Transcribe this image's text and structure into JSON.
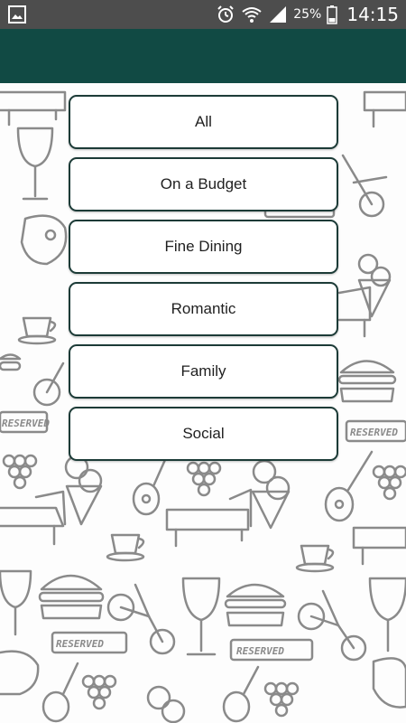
{
  "status_bar": {
    "battery": "25%",
    "time": "14:15",
    "icons": [
      "image-icon",
      "alarm-icon",
      "wifi-icon",
      "signal-icon",
      "battery-icon"
    ]
  },
  "app_bar": {
    "color": "#114a44"
  },
  "categories": [
    {
      "label": "All"
    },
    {
      "label": "On a Budget"
    },
    {
      "label": "Fine Dining"
    },
    {
      "label": "Romantic"
    },
    {
      "label": "Family"
    },
    {
      "label": "Social"
    }
  ],
  "background": {
    "doodle_texts": [
      "RESERVED",
      "RESERVED",
      "RESERVED",
      "RESERVED",
      "RESERVED"
    ]
  },
  "colors": {
    "accent": "#114a44",
    "button_border": "#1c3b37",
    "doodle_stroke": "#8a8a8a"
  }
}
